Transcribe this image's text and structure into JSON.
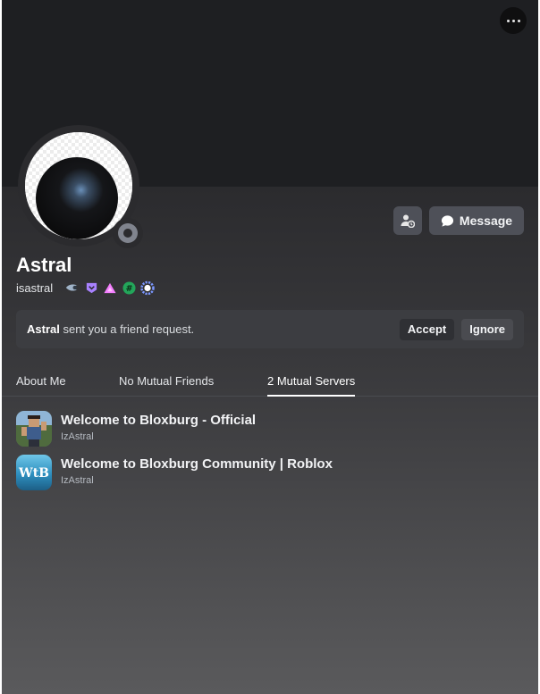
{
  "profile": {
    "display_name": "Astral",
    "username": "isastral",
    "badges": [
      "hypesquad-icon",
      "nitro-icon",
      "boost-icon",
      "active-developer-icon",
      "quest-icon"
    ]
  },
  "actions": {
    "message_label": "Message"
  },
  "friend_request": {
    "name": "Astral",
    "text": " sent you a friend request.",
    "accept_label": "Accept",
    "ignore_label": "Ignore"
  },
  "tabs": [
    {
      "label": "About Me"
    },
    {
      "label": "No Mutual Friends"
    },
    {
      "label": "2 Mutual Servers"
    }
  ],
  "servers": [
    {
      "name": "Welcome to Bloxburg - Official",
      "nickname": "IzAstral"
    },
    {
      "name": "Welcome to Bloxburg Community | Roblox",
      "nickname": "IzAstral",
      "icon_text": "WtB"
    }
  ],
  "colors": {
    "banner": "#1e1f22",
    "button": "#4e5058",
    "request_bar": "#3c3d41"
  }
}
